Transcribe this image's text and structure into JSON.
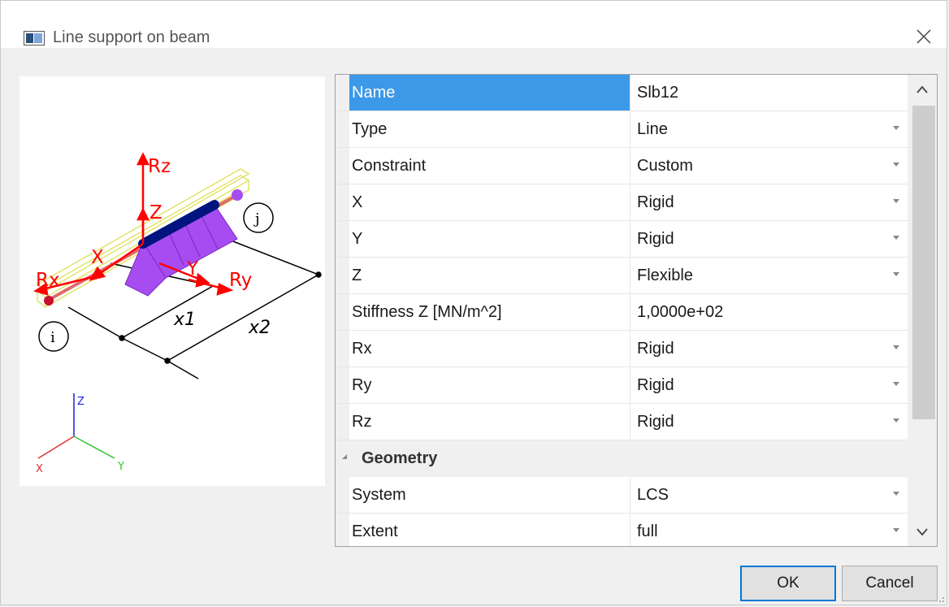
{
  "window": {
    "title": "Line support on beam",
    "icon": "window-icon",
    "close_icon": "close-icon"
  },
  "preview": {
    "labels": {
      "rz": "Rz",
      "z": "Z",
      "x": "X",
      "rx": "Rx",
      "y": "Y",
      "ry": "Ry",
      "x1": "x1",
      "x2": "x2",
      "i": "i",
      "j": "j",
      "axis_z": "Z",
      "axis_x": "X",
      "axis_y": "Y"
    }
  },
  "properties": [
    {
      "name": "Name",
      "value": "Slb12",
      "dropdown": false,
      "selected": true
    },
    {
      "name": "Type",
      "value": "Line",
      "dropdown": true
    },
    {
      "name": "Constraint",
      "value": "Custom",
      "dropdown": true
    },
    {
      "name": "X",
      "value": "Rigid",
      "dropdown": true
    },
    {
      "name": "Y",
      "value": "Rigid",
      "dropdown": true
    },
    {
      "name": "Z",
      "value": "Flexible",
      "dropdown": true
    },
    {
      "name": "Stiffness Z [MN/m^2]",
      "value": "1,0000e+02",
      "dropdown": false
    },
    {
      "name": "Rx",
      "value": "Rigid",
      "dropdown": true
    },
    {
      "name": "Ry",
      "value": "Rigid",
      "dropdown": true
    },
    {
      "name": "Rz",
      "value": "Rigid",
      "dropdown": true
    }
  ],
  "geometry": {
    "label": "Geometry",
    "items": [
      {
        "name": "System",
        "value": "LCS",
        "dropdown": true
      },
      {
        "name": "Extent",
        "value": "full",
        "dropdown": true
      }
    ]
  },
  "buttons": {
    "ok": "OK",
    "cancel": "Cancel"
  },
  "colors": {
    "accent": "#0078d7",
    "selection": "#3b99e8",
    "support": "#a64cf0",
    "arrows": "#ff0000"
  }
}
